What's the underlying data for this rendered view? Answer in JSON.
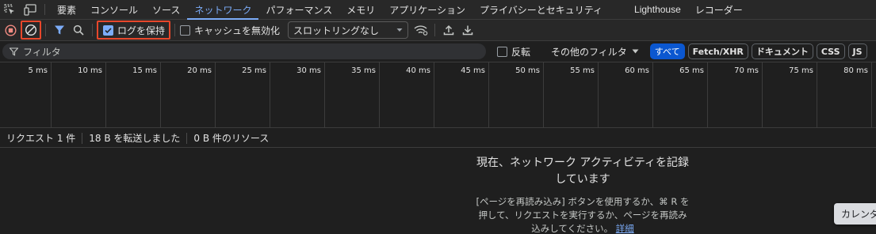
{
  "tabs": [
    {
      "label": "要素"
    },
    {
      "label": "コンソール"
    },
    {
      "label": "ソース"
    },
    {
      "label": "ネットワーク",
      "active": true
    },
    {
      "label": "パフォーマンス"
    },
    {
      "label": "メモリ"
    },
    {
      "label": "アプリケーション"
    },
    {
      "label": "プライバシーとセキュリティ"
    },
    {
      "label": "Lighthouse"
    },
    {
      "label": "レコーダー"
    }
  ],
  "toolbar": {
    "preserve_log_label": "ログを保持",
    "preserve_log_checked": true,
    "disable_cache_label": "キャッシュを無効化",
    "disable_cache_checked": false,
    "throttling_value": "スロットリングなし"
  },
  "filter": {
    "placeholder": "フィルタ",
    "invert_label": "反転",
    "other_filters_label": "その他のフィルタ",
    "types": [
      {
        "label": "すべて",
        "active": true
      },
      {
        "label": "Fetch/XHR"
      },
      {
        "label": "ドキュメント"
      },
      {
        "label": "CSS"
      },
      {
        "label": "JS"
      }
    ]
  },
  "timeline": {
    "ticks": [
      "5 ms",
      "10 ms",
      "15 ms",
      "20 ms",
      "25 ms",
      "30 ms",
      "35 ms",
      "40 ms",
      "45 ms",
      "50 ms",
      "55 ms",
      "60 ms",
      "65 ms",
      "70 ms",
      "75 ms",
      "80 ms"
    ]
  },
  "status": {
    "requests": "リクエスト 1 件",
    "transferred": "18 B を転送しました",
    "resources": "0 B 件のリソース"
  },
  "empty": {
    "title": "現在、ネットワーク アクティビティを記録しています",
    "desc": "[ページを再読み込み] ボタンを使用するか、⌘ R を押して、リクエストを実行するか、ページを再読み込みしてください。",
    "link": "詳細"
  },
  "tooltip": "カレンダ",
  "colors": {
    "accent": "#7cacf8",
    "highlight": "#e8472b",
    "record": "#f28b82",
    "filter_icon": "#7cacf8"
  }
}
